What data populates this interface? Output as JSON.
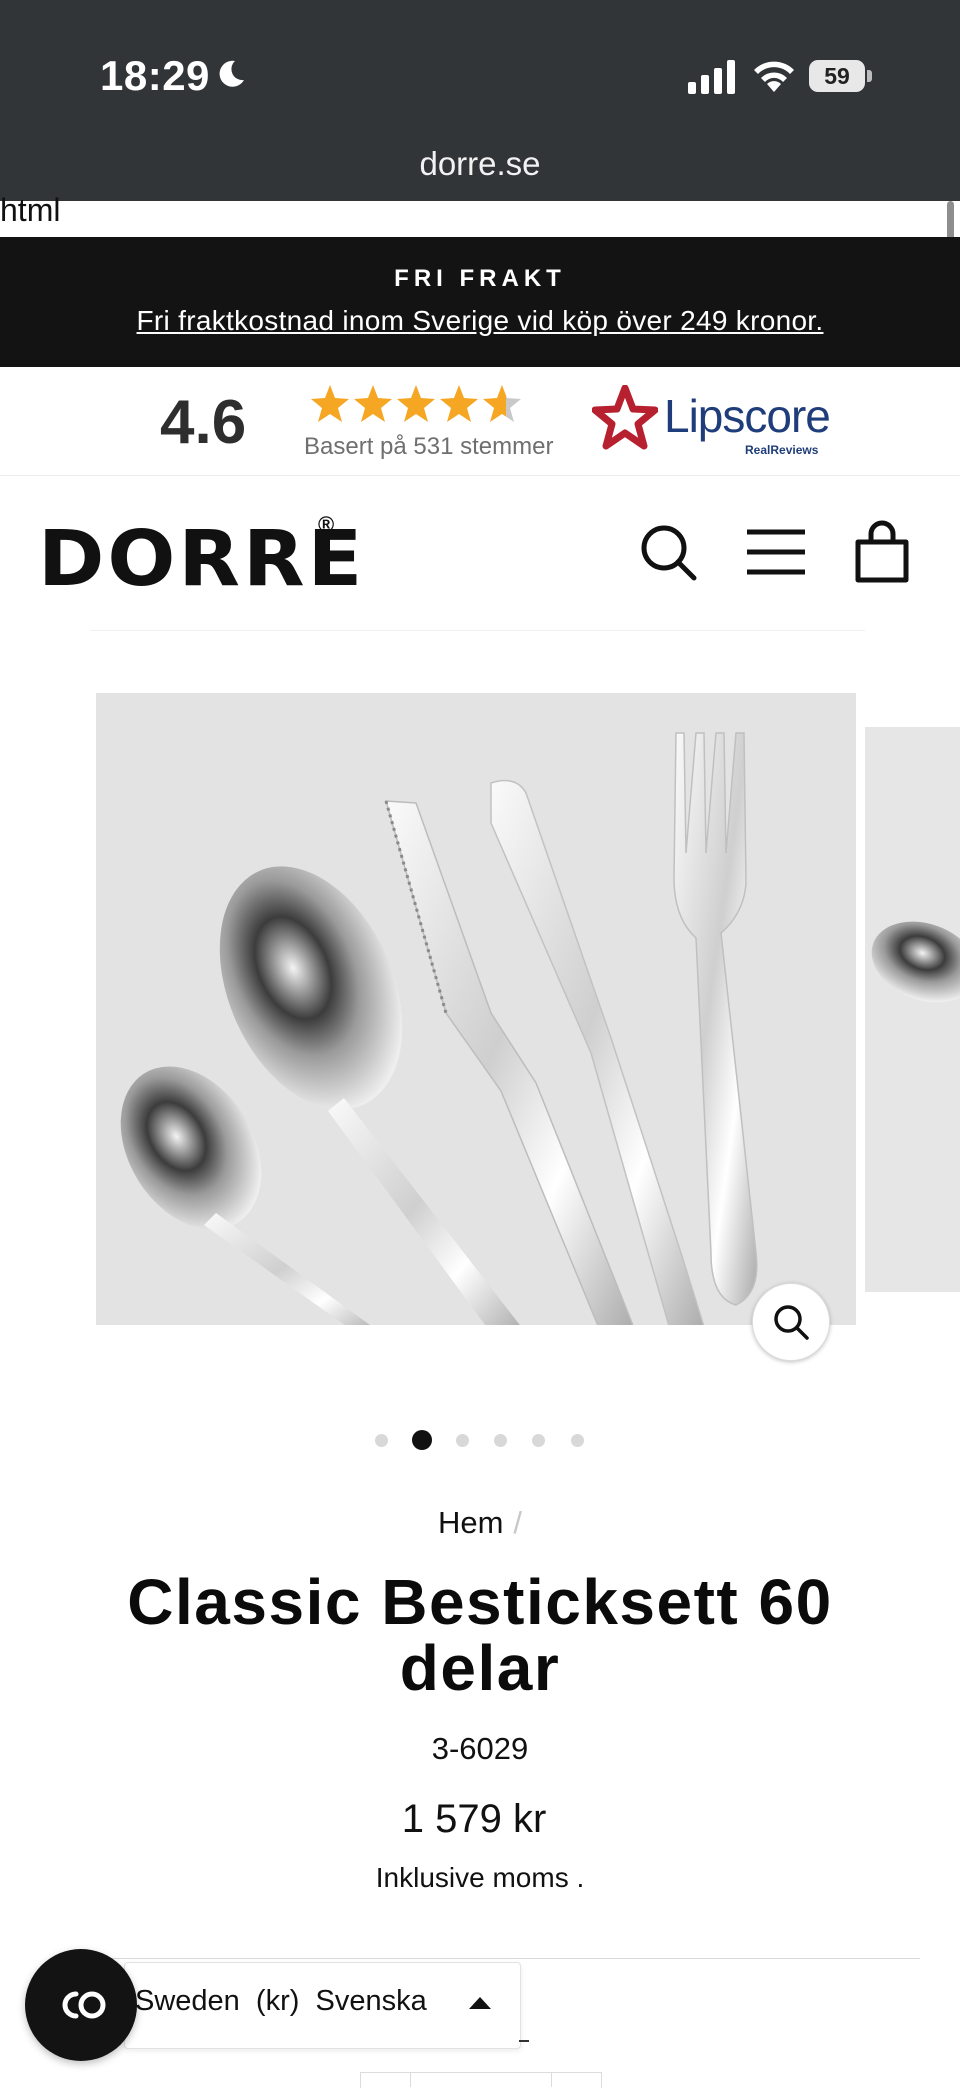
{
  "status_bar": {
    "time": "18:29",
    "battery": "59",
    "icons": [
      "moon-icon",
      "signal-icon",
      "wifi-icon",
      "battery-icon"
    ]
  },
  "browser": {
    "url": "dorre.se"
  },
  "stray_text": "html",
  "announcement": {
    "title": "FRI FRAKT",
    "text": "Fri fraktkostnad inom Sverige vid köp över 249 kronor."
  },
  "reviews": {
    "score": "4.6",
    "stars_value": 4.6,
    "stars_max": 5,
    "votes_text": "Basert på 531 stemmer",
    "provider": "Lipscore",
    "provider_sub": "RealReviews"
  },
  "header": {
    "logo": "DORRE",
    "logo_mark": "®",
    "icons": [
      "search-icon",
      "menu-icon",
      "cart-icon"
    ]
  },
  "gallery": {
    "image_count": 6,
    "active_index": 1,
    "main_image": "cutlery-set-photo",
    "zoom_icon": "zoom-icon"
  },
  "product": {
    "breadcrumb_home": "Hem",
    "breadcrumb_sep": "/",
    "title": "Classic Besticksett 60 delar",
    "sku": "3-6029",
    "price": "1 579 kr",
    "vat_note": "Inklusive moms ."
  },
  "locale": {
    "country": "Sweden",
    "currency": "(kr)",
    "language": "Svenska",
    "display": "Sweden  (kr)  Svenska"
  },
  "colors": {
    "status_bar_bg": "#323538",
    "banner_bg": "#131313",
    "star": "#f5a623",
    "lipscore_red": "#b7202e",
    "lipscore_blue": "#1f3d7a"
  }
}
